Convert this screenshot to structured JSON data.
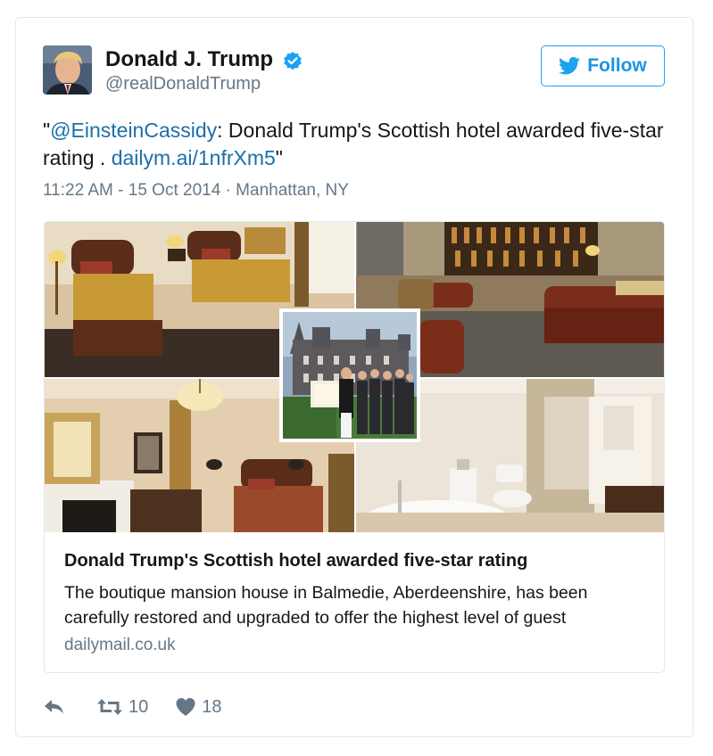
{
  "user": {
    "display_name": "Donald J. Trump",
    "handle": "@realDonaldTrump",
    "verified": true
  },
  "follow_button": {
    "label": "Follow",
    "icon": "twitter-bird-icon"
  },
  "tweet": {
    "quote_open": "\"",
    "mention": "@EinsteinCassidy",
    "text": ": Donald Trump's Scottish hotel awarded five-star rating . ",
    "link": "dailym.ai/1nfrXm5",
    "quote_close": "\""
  },
  "meta": {
    "time": "11:22 AM - 15 Oct 2014",
    "separator": " · ",
    "location": "Manhattan, NY"
  },
  "card": {
    "title": "Donald Trump's Scottish hotel awarded five-star rating",
    "description": "The boutique mansion house in Balmedie, Aberdeenshire, has been carefully restored and upgraded to offer the highest level of guest",
    "domain": "dailymail.co.uk",
    "image": "collage of hotel bedrooms, lounge, bathroom and staff in front of mansion"
  },
  "actions": {
    "reply_icon": "reply-icon",
    "retweet_icon": "retweet-icon",
    "retweet_count": "10",
    "like_icon": "heart-icon",
    "like_count": "18"
  },
  "colors": {
    "link": "#1b6fa8",
    "follow_blue": "#1da1f2",
    "muted_text": "#657786",
    "border": "#e1e8ed"
  }
}
